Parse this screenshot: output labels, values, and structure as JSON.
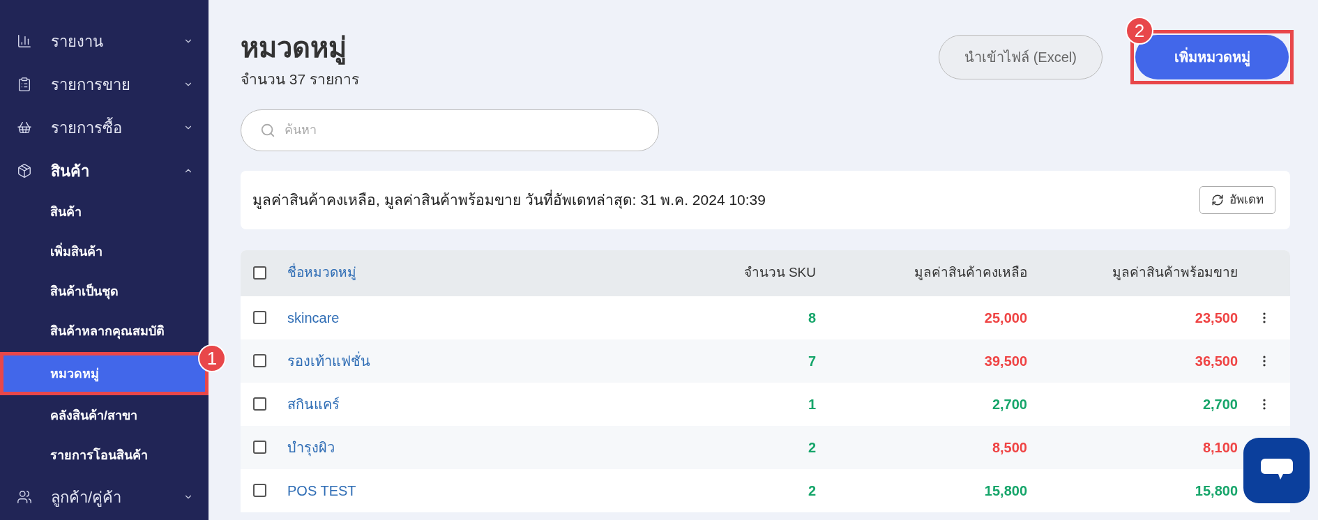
{
  "sidebar": {
    "items": [
      {
        "label": "รายงาน",
        "expanded": false
      },
      {
        "label": "รายการขาย",
        "expanded": false
      },
      {
        "label": "รายการซื้อ",
        "expanded": false
      },
      {
        "label": "สินค้า",
        "expanded": true,
        "children": [
          {
            "label": "สินค้า",
            "selected": false
          },
          {
            "label": "เพิ่มสินค้า",
            "selected": false
          },
          {
            "label": "สินค้าเป็นชุด",
            "selected": false
          },
          {
            "label": "สินค้าหลากคุณสมบัติ",
            "selected": false
          },
          {
            "label": "หมวดหมู่",
            "selected": true,
            "annotation": "1"
          },
          {
            "label": "คลังสินค้า/สาขา",
            "selected": false
          },
          {
            "label": "รายการโอนสินค้า",
            "selected": false
          }
        ]
      },
      {
        "label": "ลูกค้า/คู่ค้า",
        "expanded": false
      }
    ]
  },
  "page": {
    "title": "หมวดหมู่",
    "subtitle": "จำนวน 37 รายการ"
  },
  "buttons": [
    {
      "label": "นำเข้าไฟล์ (Excel)",
      "kind": "secondary"
    },
    {
      "label": "เพิ่มหมวดหมู่",
      "kind": "primary",
      "annotation": "2"
    }
  ],
  "search": {
    "placeholder": "ค้นหา"
  },
  "info": {
    "text": "มูลค่าสินค้าคงเหลือ, มูลค่าสินค้าพร้อมขาย วันที่อัพเดทล่าสุด: 31 พ.ค. 2024 10:39",
    "button": "อัพเดท"
  },
  "table": {
    "header_checked": false,
    "columns": [
      "ชื่อหมวดหมู่",
      "จำนวน SKU",
      "มูลค่าสินค้าคงเหลือ",
      "มูลค่าสินค้าพร้อมขาย"
    ],
    "rows": [
      {
        "checked": false,
        "name": "skincare",
        "sku": "8",
        "stock_value": {
          "text": "25,000",
          "color": "#ef4444"
        },
        "sale_value": {
          "text": "23,500",
          "color": "#ef4444"
        }
      },
      {
        "checked": false,
        "name": "รองเท้าแฟชั่น",
        "sku": "7",
        "stock_value": {
          "text": "39,500",
          "color": "#ef4444"
        },
        "sale_value": {
          "text": "36,500",
          "color": "#ef4444"
        }
      },
      {
        "checked": false,
        "name": "สกินแคร์",
        "sku": "1",
        "stock_value": {
          "text": "2,700",
          "color": "#16a56a"
        },
        "sale_value": {
          "text": "2,700",
          "color": "#16a56a"
        }
      },
      {
        "checked": false,
        "name": "บำรุงผิว",
        "sku": "2",
        "stock_value": {
          "text": "8,500",
          "color": "#ef4444"
        },
        "sale_value": {
          "text": "8,100",
          "color": "#ef4444"
        }
      },
      {
        "checked": false,
        "name": "POS TEST",
        "sku": "2",
        "stock_value": {
          "text": "15,800",
          "color": "#16a56a"
        },
        "sale_value": {
          "text": "15,800",
          "color": "#16a56a"
        }
      }
    ]
  },
  "chat_button": true
}
